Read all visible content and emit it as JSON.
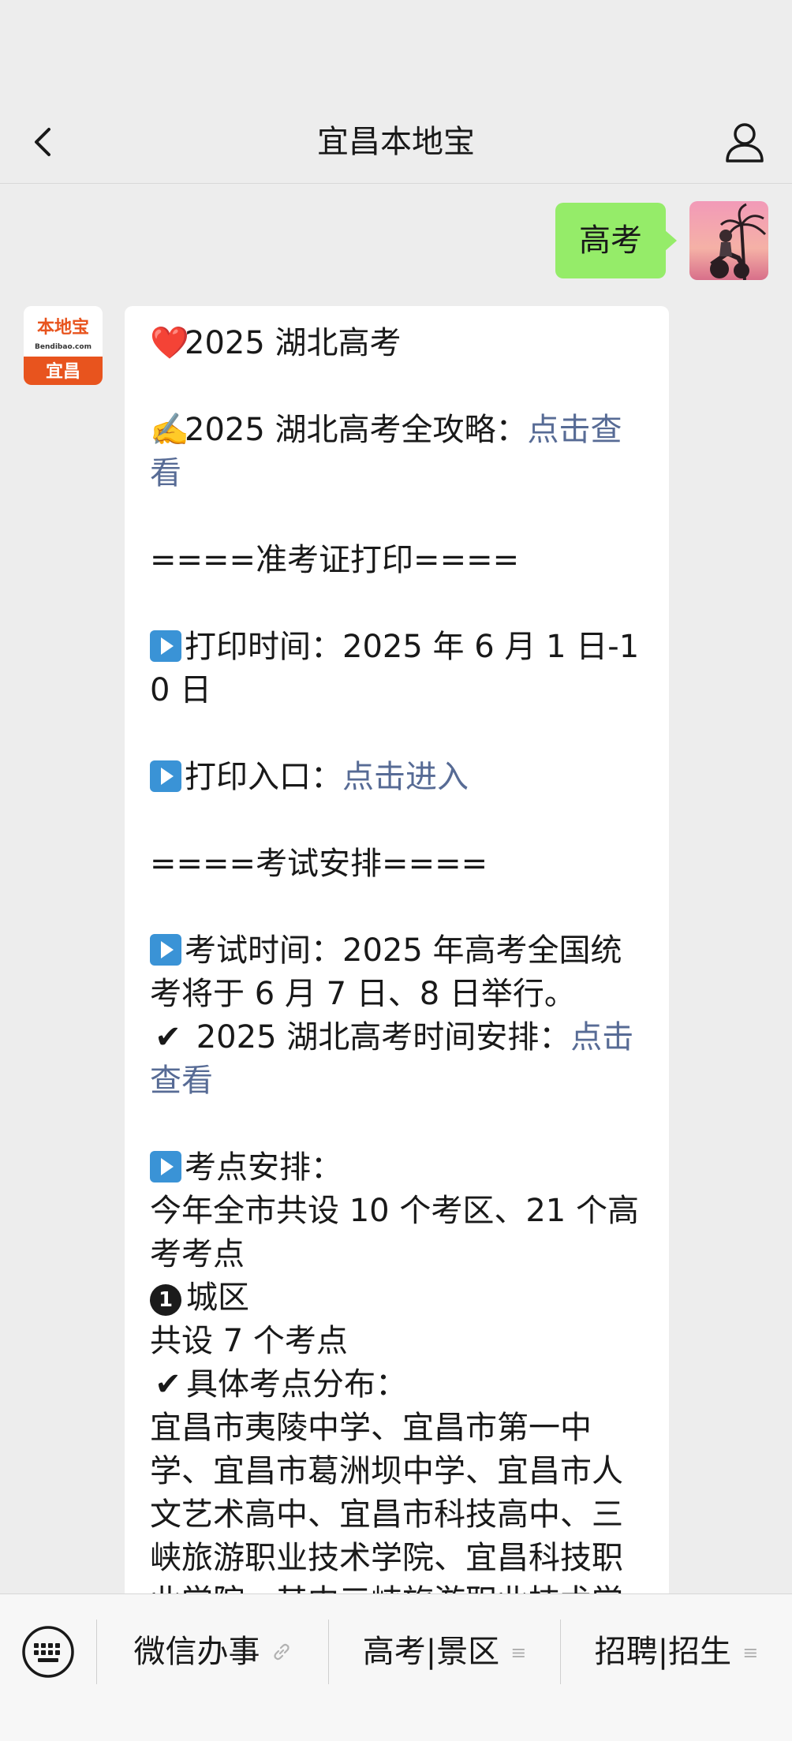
{
  "nav": {
    "title": "宜昌本地宝",
    "back_icon": "chevron-left-icon",
    "profile_icon": "person-icon"
  },
  "outgoing": {
    "text": "高考",
    "bubble_color": "#95ec69"
  },
  "incoming_avatar": {
    "line1": "本地宝",
    "line2": "Bendibao.com",
    "line3": "宜昌",
    "accent": "#e8541e"
  },
  "message": {
    "heart": "❤️",
    "writing": "✍️",
    "line_title": "2025 湖北高考",
    "guide_text": "2025 湖北高考全攻略：",
    "guide_link": "点击查看",
    "sec_admission": "====准考证打印====",
    "print_time": "打印时间：2025 年 6 月 1 日-10 日",
    "print_entry": "打印入口：",
    "print_entry_link": "点击进入",
    "sec_exam": "====考试安排====",
    "exam_time": "考试时间：2025 年高考全国统考将于 6 月 7 日、8 日举行。",
    "schedule_text": " 2025 湖北高考时间安排：",
    "schedule_link": "点击查看",
    "venue_title": "考点安排：",
    "venue_summary": "今年全市共设 10 个考区、21 个高考考点",
    "district_num": "1",
    "district_name": "城区",
    "district_count": "共设 7 个考点",
    "detail_title": "具体考点分布：",
    "detail_text": "宜昌市夷陵中学、宜昌市第一中学、宜昌市葛洲坝中学、宜昌市人文艺术高中、宜昌市科技高中、三峡旅游职业技术学院、宜昌科技职业学院，其中三峡旅游职业技术学院",
    "link_color": "#576b95"
  },
  "menu": {
    "keyboard_icon": "keyboard-icon",
    "items": [
      {
        "label": "微信办事",
        "icon": "link-icon"
      },
      {
        "label": "高考|景区",
        "icon": "menu-lines-icon"
      },
      {
        "label": "招聘|招生",
        "icon": "menu-lines-icon"
      }
    ]
  }
}
